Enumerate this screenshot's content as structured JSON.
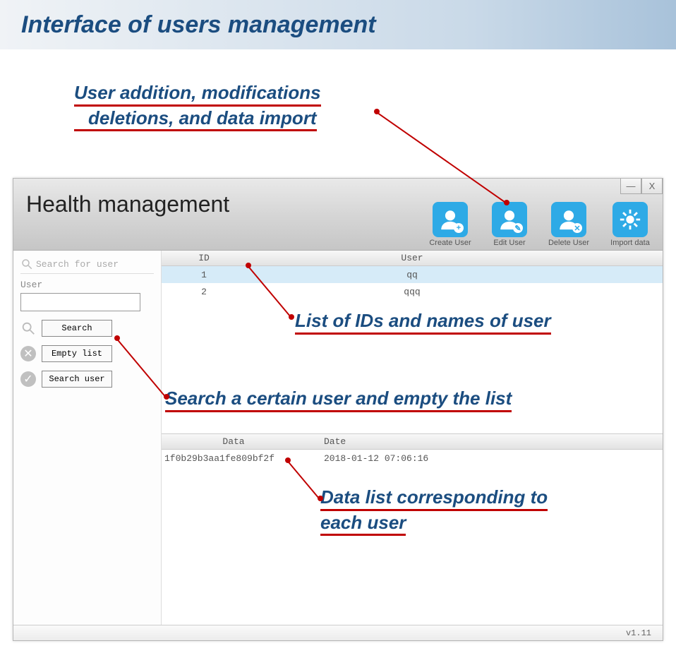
{
  "doc_title": "Interface of users management",
  "annotations": {
    "toolbar_line1": "User addition, modifications",
    "toolbar_line2": "deletions, and data import",
    "user_list": "List of IDs and names of user",
    "search": "Search a certain user and empty the list",
    "data_list_line1": "Data list corresponding to",
    "data_list_line2": "each user"
  },
  "app": {
    "title": "Health management",
    "version": "v1.11",
    "window_controls": {
      "minimize": "—",
      "close": "X"
    },
    "toolbar": {
      "create": "Create User",
      "edit": "Edit User",
      "delete": "Delete User",
      "import": "Import data"
    },
    "sidebar": {
      "search_title": "Search for user",
      "user_label": "User",
      "input_value": "",
      "search_btn": "Search",
      "empty_btn": "Empty list",
      "searchuser_btn": "Search user"
    },
    "user_table": {
      "headers": {
        "id": "ID",
        "user": "User"
      },
      "rows": [
        {
          "id": "1",
          "user": "qq",
          "selected": true
        },
        {
          "id": "2",
          "user": "qqq",
          "selected": false
        }
      ]
    },
    "data_table": {
      "headers": {
        "data": "Data",
        "date": "Date"
      },
      "rows": [
        {
          "data": "1f0b29b3aa1fe809bf2f",
          "date": "2018-01-12 07:06:16"
        }
      ]
    }
  }
}
